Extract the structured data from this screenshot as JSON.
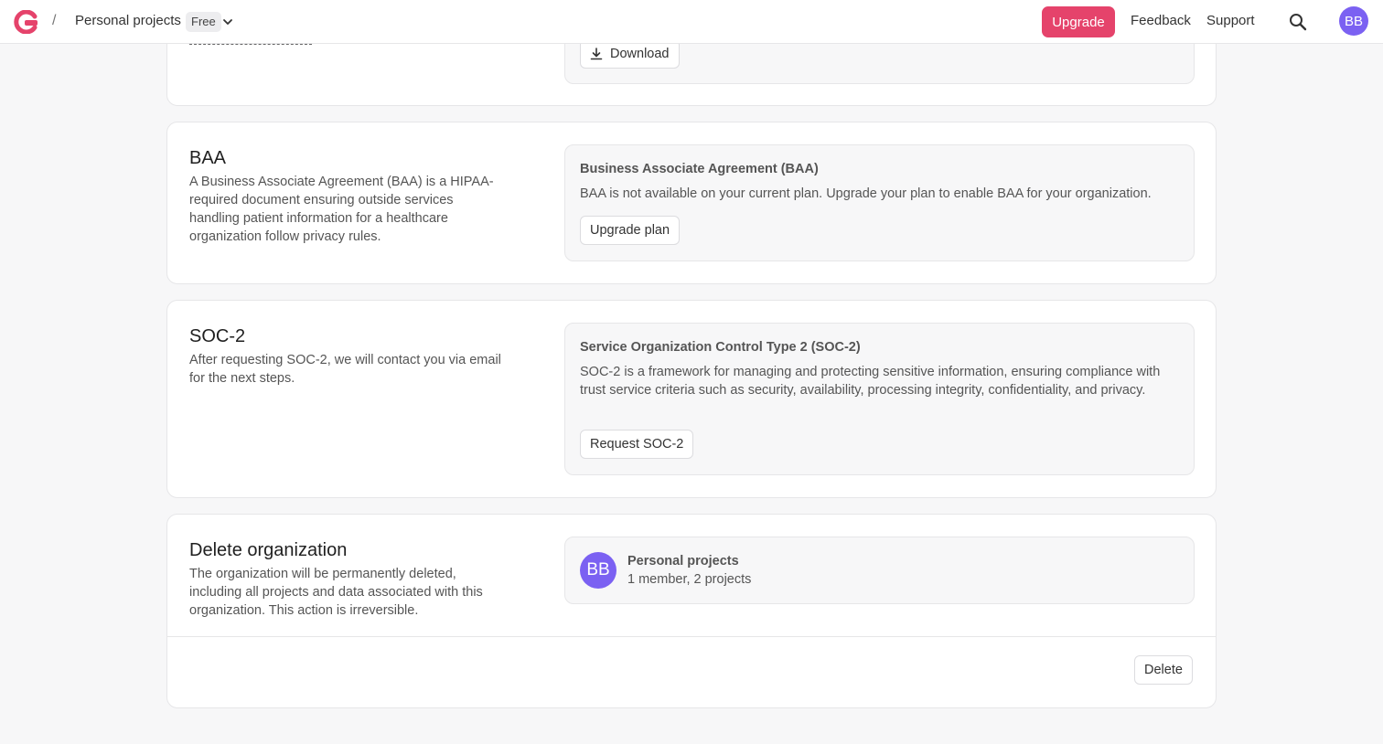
{
  "topbar": {
    "breadcrumb_separator": "/",
    "org_name": "Personal projects",
    "plan_badge": "Free",
    "upgrade_label": "Upgrade",
    "feedback_label": "Feedback",
    "support_label": "Support",
    "avatar_initials": "BB"
  },
  "download_card": {
    "download_label": "Download"
  },
  "baa": {
    "title": "BAA",
    "description": "A Business Associate Agreement (BAA) is a HIPAA-required document ensuring outside services handling patient information for a healthcare organization follow privacy rules.",
    "panel_title": "Business Associate Agreement (BAA)",
    "panel_text": "BAA is not available on your current plan. Upgrade your plan to enable BAA for your organization.",
    "button_label": "Upgrade plan"
  },
  "soc2": {
    "title": "SOC-2",
    "description": "After requesting SOC-2, we will contact you via email for the next steps.",
    "panel_title": "Service Organization Control Type 2 (SOC-2)",
    "panel_text": "SOC-2 is a framework for managing and protecting sensitive information, ensuring compliance with trust service criteria such as security, availability, processing integrity, confidentiality, and privacy.",
    "button_label": "Request SOC-2"
  },
  "delete_org": {
    "title": "Delete organization",
    "description": "The organization will be permanently deleted, including all projects and data associated with this organization. This action is irreversible.",
    "org_avatar_initials": "BB",
    "org_name": "Personal projects",
    "org_meta": "1 member, 2 projects",
    "delete_label": "Delete"
  },
  "colors": {
    "accent": "#e5436b",
    "avatar": "#7b61f2"
  }
}
